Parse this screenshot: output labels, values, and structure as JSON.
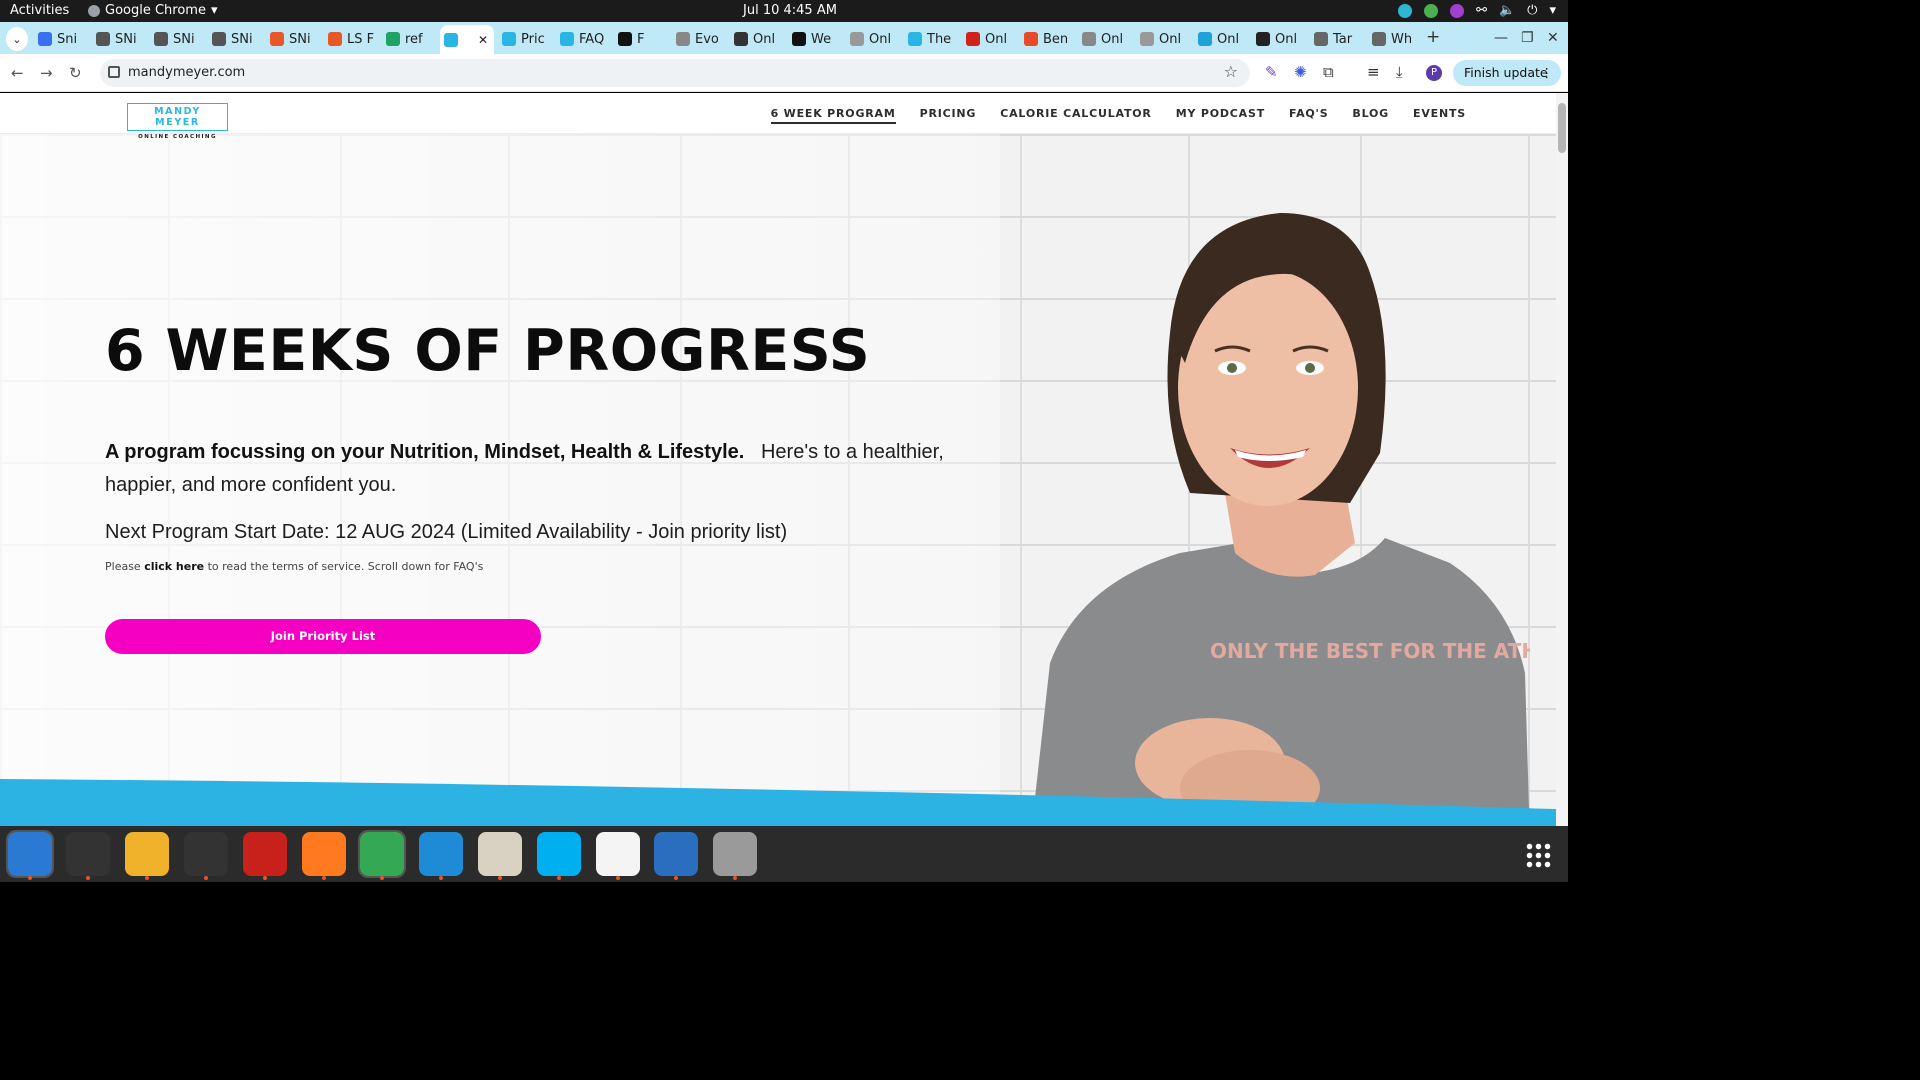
{
  "system": {
    "activities": "Activities",
    "app_name": "Google Chrome",
    "clock": "Jul 10  4:45 AM"
  },
  "tabs": [
    {
      "label": "Sni",
      "color": "#3a6ff0"
    },
    {
      "label": "SNi",
      "color": "#555"
    },
    {
      "label": "SNi",
      "color": "#555"
    },
    {
      "label": "SNi",
      "color": "#555"
    },
    {
      "label": "SNi",
      "color": "#e8572a"
    },
    {
      "label": "LS F",
      "color": "#e8572a"
    },
    {
      "label": "ref",
      "color": "#1ea362"
    },
    {
      "label": "",
      "color": "#29b6e4",
      "active": true
    },
    {
      "label": "Pric",
      "color": "#29b6e4"
    },
    {
      "label": "FAQ",
      "color": "#29b6e4"
    },
    {
      "label": "F",
      "color": "#111"
    },
    {
      "label": "Evo",
      "color": "#888"
    },
    {
      "label": "Onl",
      "color": "#333"
    },
    {
      "label": "We",
      "color": "#111"
    },
    {
      "label": "Onl",
      "color": "#999"
    },
    {
      "label": "The",
      "color": "#29b6e4"
    },
    {
      "label": "Onl",
      "color": "#d0221a"
    },
    {
      "label": "Ben",
      "color": "#e84b2a"
    },
    {
      "label": "Onl",
      "color": "#888"
    },
    {
      "label": "Onl",
      "color": "#999"
    },
    {
      "label": "Onl",
      "color": "#1ea3d8"
    },
    {
      "label": "Onl",
      "color": "#222"
    },
    {
      "label": "Tar",
      "color": "#666"
    },
    {
      "label": "Wh",
      "color": "#666"
    }
  ],
  "toolbar": {
    "url": "mandymeyer.com",
    "finish_update": "Finish update",
    "profile_initial": "P"
  },
  "site": {
    "logo_name": "MANDY MEYER",
    "logo_sub": "ONLINE COACHING",
    "nav": [
      {
        "label": "6 WEEK PROGRAM",
        "current": true
      },
      {
        "label": "PRICING"
      },
      {
        "label": "CALORIE CALCULATOR"
      },
      {
        "label": "MY PODCAST"
      },
      {
        "label": "FAQ'S"
      },
      {
        "label": "BLOG"
      },
      {
        "label": "EVENTS"
      }
    ],
    "hero": {
      "title": "6 WEEKS OF PROGRESS",
      "intro_bold": "A program focussing on your Nutrition, Mindset, Health & Lifestyle.",
      "intro_rest": "Here's to a healthier, happier, and more confident you.",
      "start_date": "Next Program Start Date: 12 AUG 2024 (Limited Availability - Join priority list)",
      "terms_prefix": "Please ",
      "terms_link": "click here",
      "terms_suffix": " to read the terms of service. Scroll down for FAQ's",
      "cta": "Join Priority List",
      "shirt_text": "ONLY THE BEST FOR THE ATH"
    },
    "accent_color": "#f500c3",
    "brand_color": "#29b6e4"
  },
  "dock": [
    {
      "name": "thunderbird-icon",
      "color": "#2a7ad4"
    },
    {
      "name": "terminal-icon",
      "color": "#333"
    },
    {
      "name": "calculator-icon",
      "color": "#f0b22a"
    },
    {
      "name": "system-monitor-icon",
      "color": "#333"
    },
    {
      "name": "filezilla-icon",
      "color": "#c8201b"
    },
    {
      "name": "firefox-icon",
      "color": "#ff7a1f"
    },
    {
      "name": "chrome-icon",
      "color": "#34a853"
    },
    {
      "name": "vscode-icon",
      "color": "#1f8ad6"
    },
    {
      "name": "files-icon",
      "color": "#d9d2c2"
    },
    {
      "name": "skype-icon",
      "color": "#00aff0"
    },
    {
      "name": "text-editor-icon",
      "color": "#f4f4f4"
    },
    {
      "name": "writer-icon",
      "color": "#2a6fbf"
    },
    {
      "name": "disk-icon",
      "color": "#9a9a9a"
    }
  ]
}
